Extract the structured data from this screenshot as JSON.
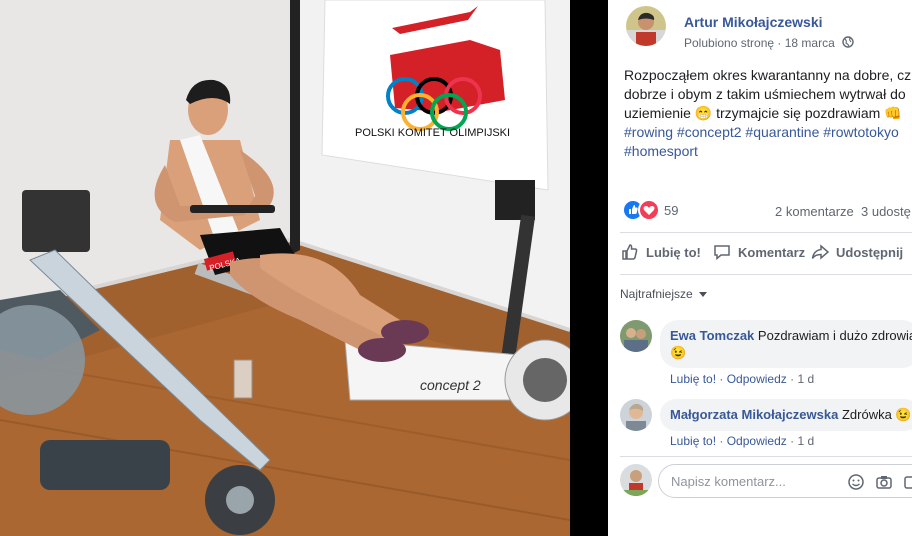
{
  "post": {
    "author": "Artur Mikołajczewski",
    "liked_text": "Polubiono stronę",
    "separator": " · ",
    "date": "18 marca",
    "body_lines": [
      "Rozpocząłem okres kwarantanny na dobre, cz",
      "dobrze i obym z takim uśmiechem wytrwał do",
      "uziemienie 😁 trzymajcie się pozdrawiam 👊"
    ],
    "hashtags_line1": [
      "#rowing",
      "#concept2",
      "#quarantine",
      "#rowtotokyo"
    ],
    "hashtags_line2": [
      "#homesport"
    ]
  },
  "photo": {
    "flag_text": "POLSKI  KOMITET  OLIMPIJSKI",
    "shorts_text": "POLSKA",
    "machine_text": "concept 2"
  },
  "reactions": {
    "count": "59",
    "comments": "2 komentarze",
    "shares": "3 udostę"
  },
  "actions": {
    "like": "Lubię to!",
    "comment": "Komentarz",
    "share": "Udostępnij"
  },
  "sort_label": "Najtrafniejsze",
  "comments": [
    {
      "name": "Ewa Tomczak",
      "text": "Pozdrawiam i dużo zdrowia",
      "emoji": "😉",
      "like": "Lubię to!",
      "reply": "Odpowiedz",
      "age": "1 d"
    },
    {
      "name": "Małgorzata Mikołajczewska",
      "text": "Zdrówka 😉",
      "like": "Lubię to!",
      "reply": "Odpowiedz",
      "age": "1 d"
    }
  ],
  "compose_placeholder": "Napisz komentarz...",
  "colors": {
    "link": "#385898",
    "like_blue": "#1877f2",
    "love_red": "#f33e58"
  }
}
